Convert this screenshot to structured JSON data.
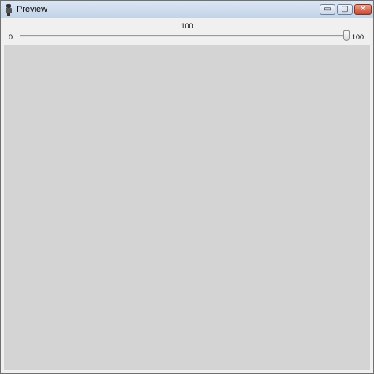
{
  "window": {
    "title": "Preview"
  },
  "titlebar_buttons": {
    "minimize": "▭",
    "maximize": "▢",
    "close": "✕"
  },
  "slider": {
    "value_text": "100",
    "min_text": "0",
    "max_text": "100",
    "position": 1.0
  },
  "colors": {
    "background": "#d4d4d4"
  }
}
